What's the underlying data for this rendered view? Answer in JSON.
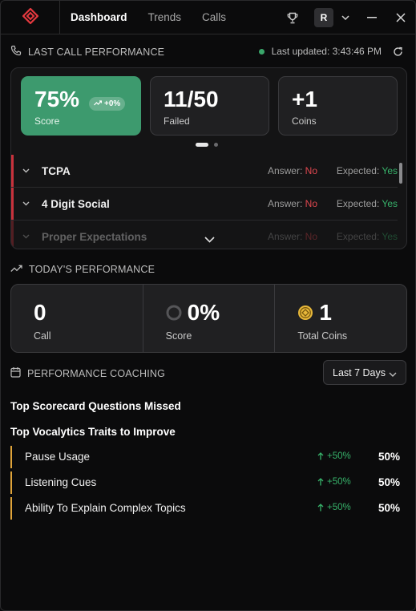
{
  "nav": {
    "items": [
      {
        "label": "Dashboard",
        "active": true
      },
      {
        "label": "Trends",
        "active": false
      },
      {
        "label": "Calls",
        "active": false
      }
    ],
    "avatar_initial": "R"
  },
  "last_call": {
    "section_title": "LAST CALL PERFORMANCE",
    "last_updated": "Last updated: 3:43:46 PM",
    "cards": {
      "score": {
        "value": "75%",
        "label": "Score",
        "trend": "+0%"
      },
      "failed": {
        "value": "11/50",
        "label": "Failed"
      },
      "coins": {
        "value": "+1",
        "label": "Coins"
      }
    },
    "carousel": {
      "pages": 2,
      "active_index": 0
    },
    "questions": [
      {
        "name": "TCPA",
        "answer_label": "Answer:",
        "answer": "No",
        "expected_label": "Expected:",
        "expected": "Yes"
      },
      {
        "name": "4 Digit Social",
        "answer_label": "Answer:",
        "answer": "No",
        "expected_label": "Expected:",
        "expected": "Yes"
      },
      {
        "name": "Proper Expectations",
        "answer_label": "Answer:",
        "answer": "No",
        "expected_label": "Expected:",
        "expected": "Yes"
      }
    ]
  },
  "today": {
    "section_title": "TODAY'S PERFORMANCE",
    "call": {
      "value": "0",
      "label": "Call"
    },
    "score": {
      "value": "0%",
      "label": "Score"
    },
    "coins": {
      "value": "1",
      "label": "Total Coins"
    }
  },
  "coaching": {
    "section_title": "PERFORMANCE COACHING",
    "period": "Last 7 Days",
    "missed_heading": "Top Scorecard Questions Missed",
    "traits_heading": "Top Vocalytics Traits to Improve",
    "traits": [
      {
        "name": "Pause Usage",
        "change": "+50%",
        "value": "50%"
      },
      {
        "name": "Listening Cues",
        "change": "+50%",
        "value": "50%"
      },
      {
        "name": "Ability To Explain Complex Topics",
        "change": "+50%",
        "value": "50%"
      }
    ]
  },
  "colors": {
    "accent_green": "#3d9a6e",
    "fail_red": "#c8323c",
    "pass_green": "#37b26a",
    "trait_orange": "#e0a43a",
    "coin_gold": "#e8b83a",
    "logo_red": "#e5393f"
  },
  "icons": {
    "logo": "brand-logo-icon",
    "trophy": "trophy-icon",
    "phone": "phone-icon",
    "refresh": "refresh-icon",
    "trend": "trending-up-icon",
    "calendar": "calendar-icon",
    "coin": "coin-icon"
  }
}
